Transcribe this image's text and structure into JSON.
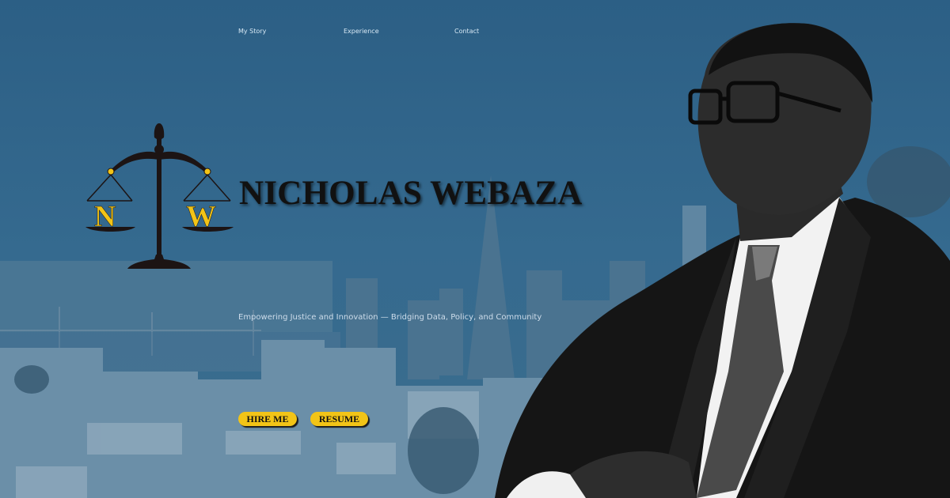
{
  "nav": {
    "items": [
      {
        "label": "My Story"
      },
      {
        "label": "Experience"
      },
      {
        "label": "Contact"
      }
    ]
  },
  "logo": {
    "letter_left": "N",
    "letter_right": "W",
    "accent_color": "#f2c417"
  },
  "hero": {
    "name": "NICHOLAS WEBAZA",
    "tagline": "Empowering Justice and Innovation — Bridging Data, Policy, and Community"
  },
  "buttons": {
    "hire": "HIRE ME",
    "resume": "RESUME"
  },
  "icons": [
    "scales-of-justice-icon"
  ],
  "colors": {
    "background": "#2f5f83",
    "button": "#f2c417",
    "name_text": "#111111"
  }
}
